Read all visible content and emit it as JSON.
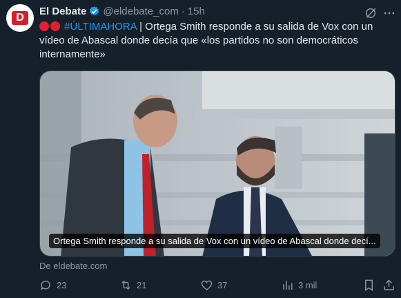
{
  "account": {
    "name": "El Debate",
    "handle": "@eldebate_com",
    "separator": "·",
    "time": "15h",
    "logo_letter": "D"
  },
  "tweet": {
    "hashtag": "#ÚLTIMAHORA",
    "body": " | Ortega Smith responde a su salida de Vox con un vídeo de Abascal donde decía que «los partidos no son democráticos internamente»"
  },
  "media": {
    "caption": "Ortega Smith responde a su salida de Vox con un vídeo de Abascal donde decí..."
  },
  "source": "De eldebate.com",
  "actions": {
    "replies": "23",
    "reposts": "21",
    "likes": "37",
    "views": "3 mil"
  },
  "colors": {
    "background": "#15202b",
    "accent": "#1d9bf0",
    "muted": "#8b98a5",
    "brand": "#d4202b"
  }
}
